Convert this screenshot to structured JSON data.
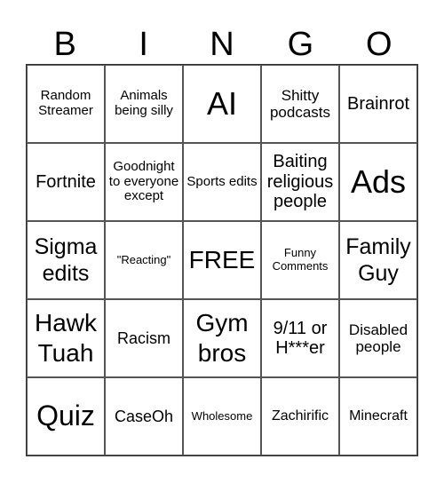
{
  "header": {
    "letters": [
      "B",
      "I",
      "N",
      "G",
      "O"
    ]
  },
  "cells": [
    [
      "Random Streamer",
      "Animals being silly",
      "AI",
      "Shitty podcasts",
      "Brainrot"
    ],
    [
      "Fortnite",
      "Goodnight to everyone except",
      "Sports edits",
      "Baiting religious people",
      "Ads"
    ],
    [
      "Sigma edits",
      "\"Reacting\"",
      "FREE",
      "Funny Comments",
      "Family Guy"
    ],
    [
      "Hawk Tuah",
      "Racism",
      "Gym bros",
      "9/11 or H***er",
      "Disabled people"
    ],
    [
      "Quiz",
      "CaseOh",
      "Wholesome",
      "Zachirific",
      "Minecraft"
    ]
  ]
}
